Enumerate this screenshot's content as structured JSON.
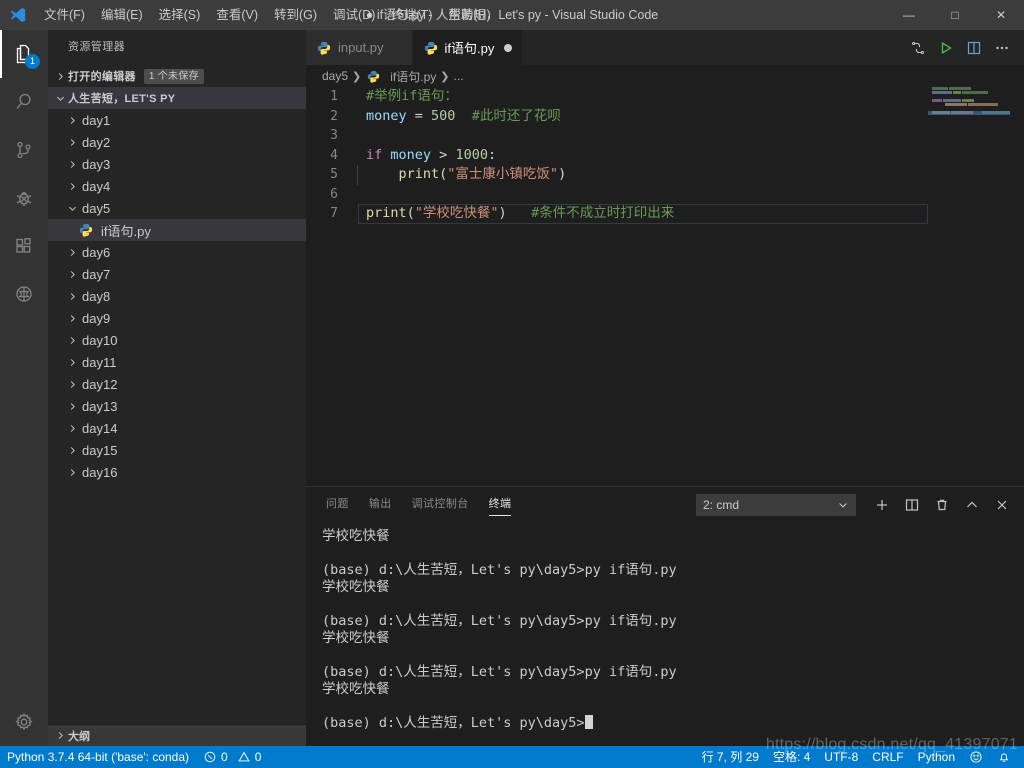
{
  "window": {
    "title": "if语句.py - 人生苦短，Let's py - Visual Studio Code",
    "dirty_indicator": "●",
    "minimize": "—",
    "maximize": "□",
    "close": "✕"
  },
  "menubar": {
    "items": [
      {
        "label": "文件(F)",
        "name": "menu-file"
      },
      {
        "label": "编辑(E)",
        "name": "menu-edit"
      },
      {
        "label": "选择(S)",
        "name": "menu-selection"
      },
      {
        "label": "查看(V)",
        "name": "menu-view"
      },
      {
        "label": "转到(G)",
        "name": "menu-goto"
      },
      {
        "label": "调试(D)",
        "name": "menu-debug"
      },
      {
        "label": "终端(T)",
        "name": "menu-terminal"
      },
      {
        "label": "帮助(H)",
        "name": "menu-help"
      }
    ]
  },
  "activitybar": {
    "items": [
      {
        "icon": "files-explorer-icon",
        "badge": "1",
        "active": true
      },
      {
        "icon": "search-icon",
        "badge": "",
        "active": false
      },
      {
        "icon": "source-control-icon",
        "badge": "",
        "active": false
      },
      {
        "icon": "debug-icon",
        "badge": "",
        "active": false
      },
      {
        "icon": "extensions-icon",
        "badge": "",
        "active": false
      },
      {
        "icon": "remote-globe-icon",
        "badge": "",
        "active": false
      }
    ],
    "settings_icon": "gear-icon"
  },
  "sidebar": {
    "title": "资源管理器",
    "open_editors": {
      "label": "打开的编辑器",
      "badge": "1 个未保存"
    },
    "workspace": {
      "label": "人生苦短，LET'S PY"
    },
    "tree": [
      {
        "label": "day1",
        "type": "folder",
        "expanded": false,
        "selected": false
      },
      {
        "label": "day2",
        "type": "folder",
        "expanded": false,
        "selected": false
      },
      {
        "label": "day3",
        "type": "folder",
        "expanded": false,
        "selected": false
      },
      {
        "label": "day4",
        "type": "folder",
        "expanded": false,
        "selected": false
      },
      {
        "label": "day5",
        "type": "folder",
        "expanded": true,
        "selected": false
      },
      {
        "label": "if语句.py",
        "type": "file",
        "expanded": false,
        "selected": true
      },
      {
        "label": "day6",
        "type": "folder",
        "expanded": false,
        "selected": false
      },
      {
        "label": "day7",
        "type": "folder",
        "expanded": false,
        "selected": false
      },
      {
        "label": "day8",
        "type": "folder",
        "expanded": false,
        "selected": false
      },
      {
        "label": "day9",
        "type": "folder",
        "expanded": false,
        "selected": false
      },
      {
        "label": "day10",
        "type": "folder",
        "expanded": false,
        "selected": false
      },
      {
        "label": "day11",
        "type": "folder",
        "expanded": false,
        "selected": false
      },
      {
        "label": "day12",
        "type": "folder",
        "expanded": false,
        "selected": false
      },
      {
        "label": "day13",
        "type": "folder",
        "expanded": false,
        "selected": false
      },
      {
        "label": "day14",
        "type": "folder",
        "expanded": false,
        "selected": false
      },
      {
        "label": "day15",
        "type": "folder",
        "expanded": false,
        "selected": false
      },
      {
        "label": "day16",
        "type": "folder",
        "expanded": false,
        "selected": false
      }
    ],
    "outline": {
      "label": "大纲"
    }
  },
  "editor": {
    "tabs": [
      {
        "label": "input.py",
        "active": false,
        "dirty": false,
        "icon": "python-file-icon"
      },
      {
        "label": "if语句.py",
        "active": true,
        "dirty": true,
        "icon": "python-file-icon"
      }
    ],
    "actions": [
      {
        "name": "run-python-file-icon"
      },
      {
        "name": "run-play-icon"
      },
      {
        "name": "split-editor-icon"
      },
      {
        "name": "more-actions-icon"
      }
    ],
    "breadcrumbs": [
      {
        "label": "day5",
        "icon": ""
      },
      {
        "label": "if语句.py",
        "icon": "python-file-icon"
      },
      {
        "label": "...",
        "icon": ""
      }
    ],
    "lines": [
      {
        "no": "1",
        "current": false,
        "indent": 0,
        "tokens": [
          {
            "t": "#举例if语句：",
            "c": "tok-comment"
          }
        ]
      },
      {
        "no": "2",
        "current": false,
        "indent": 0,
        "tokens": [
          {
            "t": "money",
            "c": "tok-var"
          },
          {
            "t": " = ",
            "c": "tok-op"
          },
          {
            "t": "500",
            "c": "tok-num"
          },
          {
            "t": "  ",
            "c": "tok-plain"
          },
          {
            "t": "#此时还了花呗",
            "c": "tok-comment"
          }
        ]
      },
      {
        "no": "3",
        "current": false,
        "indent": 0,
        "tokens": []
      },
      {
        "no": "4",
        "current": false,
        "indent": 0,
        "tokens": [
          {
            "t": "if",
            "c": "tok-kw"
          },
          {
            "t": " ",
            "c": "tok-plain"
          },
          {
            "t": "money",
            "c": "tok-var"
          },
          {
            "t": " > ",
            "c": "tok-op"
          },
          {
            "t": "1000",
            "c": "tok-num"
          },
          {
            "t": ":",
            "c": "tok-plain"
          }
        ]
      },
      {
        "no": "5",
        "current": false,
        "indent": 1,
        "tokens": [
          {
            "t": "    ",
            "c": "tok-plain"
          },
          {
            "t": "print",
            "c": "tok-func"
          },
          {
            "t": "(",
            "c": "tok-paren"
          },
          {
            "t": "\"富士康小镇吃饭\"",
            "c": "tok-str"
          },
          {
            "t": ")",
            "c": "tok-paren"
          }
        ]
      },
      {
        "no": "6",
        "current": false,
        "indent": 0,
        "tokens": []
      },
      {
        "no": "7",
        "current": true,
        "indent": 0,
        "tokens": [
          {
            "t": "print",
            "c": "tok-func"
          },
          {
            "t": "(",
            "c": "tok-paren"
          },
          {
            "t": "\"学校吃快餐\"",
            "c": "tok-str"
          },
          {
            "t": ")",
            "c": "tok-paren"
          },
          {
            "t": "   ",
            "c": "tok-plain"
          },
          {
            "t": "#条件不成立时打印出来",
            "c": "tok-comment"
          }
        ]
      }
    ],
    "minimap": [
      [
        {
          "w": 16,
          "color": "#4e6e4a"
        },
        {
          "w": 22,
          "color": "#4e6e4a"
        }
      ],
      [
        {
          "w": 20,
          "color": "#5a6e8a"
        },
        {
          "w": 8,
          "color": "#6a7a5a"
        },
        {
          "w": 26,
          "color": "#4e6e4a"
        }
      ],
      [],
      [
        {
          "w": 10,
          "color": "#7a5a80"
        },
        {
          "w": 18,
          "color": "#5a6e8a"
        },
        {
          "w": 12,
          "color": "#6a7a5a"
        }
      ],
      [
        {
          "w": 12,
          "color": "#1e1e1e"
        },
        {
          "w": 22,
          "color": "#8a7a55"
        },
        {
          "w": 30,
          "color": "#8a6a55"
        }
      ],
      [],
      [
        {
          "w": 22,
          "color": "#8a7a55"
        },
        {
          "w": 26,
          "color": "#8a6a55"
        },
        {
          "w": 8,
          "color": "#1e1e1e"
        },
        {
          "w": 34,
          "color": "#4e6e4a"
        }
      ]
    ]
  },
  "panel": {
    "tabs": [
      {
        "label": "问题",
        "active": false
      },
      {
        "label": "输出",
        "active": false
      },
      {
        "label": "调试控制台",
        "active": false
      },
      {
        "label": "终端",
        "active": true
      }
    ],
    "terminal_select": {
      "value": "2: cmd"
    },
    "actions": [
      {
        "name": "new-terminal-icon"
      },
      {
        "name": "split-terminal-icon"
      },
      {
        "name": "kill-terminal-icon"
      },
      {
        "name": "maximize-panel-icon"
      },
      {
        "name": "close-panel-icon"
      }
    ],
    "terminal_lines": [
      "学校吃快餐",
      "",
      "(base) d:\\人生苦短，Let's py\\day5>py if语句.py",
      "学校吃快餐",
      "",
      "(base) d:\\人生苦短，Let's py\\day5>py if语句.py",
      "学校吃快餐",
      "",
      "(base) d:\\人生苦短，Let's py\\day5>py if语句.py",
      "学校吃快餐",
      "",
      "(base) d:\\人生苦短，Let's py\\day5>"
    ],
    "prompt_cursor": true
  },
  "statusbar": {
    "left": [
      {
        "label": "Python 3.7.4 64-bit ('base': conda)",
        "name": "python-interpreter"
      },
      {
        "label": "0",
        "icon": "error-icon",
        "name": "error-count"
      },
      {
        "label": "0",
        "icon": "warning-icon",
        "name": "warning-count"
      }
    ],
    "right": [
      {
        "label": "行 7, 列 29",
        "name": "cursor-position"
      },
      {
        "label": "空格: 4",
        "name": "indentation"
      },
      {
        "label": "UTF-8",
        "name": "encoding"
      },
      {
        "label": "CRLF",
        "name": "eol"
      },
      {
        "label": "Python",
        "name": "language-mode"
      },
      {
        "label": "",
        "icon": "feedback-smiley-icon",
        "name": "feedback"
      },
      {
        "label": "",
        "icon": "bell-icon",
        "name": "notifications"
      }
    ]
  },
  "watermark": "https://blog.csdn.net/qq_41397071"
}
